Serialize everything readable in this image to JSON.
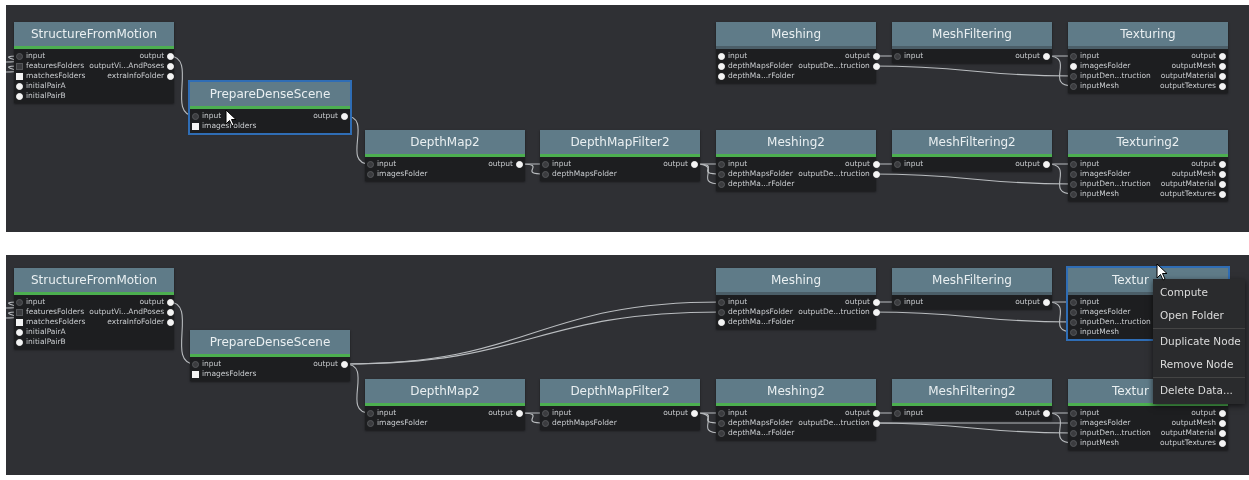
{
  "panels": [
    {
      "nodes": [
        {
          "title": "StructureFromMotion",
          "selected": false,
          "done": true,
          "inputs": [
            {
              "name": "input",
              "kind": "linked"
            },
            {
              "name": "featuresFolders",
              "kind": "linked-list"
            },
            {
              "name": "matchesFolders",
              "kind": "list"
            },
            {
              "name": "initialPairA",
              "kind": "open"
            },
            {
              "name": "initialPairB",
              "kind": "open"
            }
          ],
          "outputs": [
            {
              "name": "output",
              "kind": "open"
            },
            {
              "name": "outputVi...AndPoses",
              "kind": "open"
            },
            {
              "name": "extraInfoFolder",
              "kind": "open"
            }
          ]
        },
        {
          "title": "PrepareDenseScene",
          "selected": true,
          "done": true,
          "inputs": [
            {
              "name": "input",
              "kind": "linked"
            },
            {
              "name": "imagesFolders",
              "kind": "list"
            }
          ],
          "outputs": [
            {
              "name": "output",
              "kind": "open"
            }
          ]
        },
        {
          "title": "Meshing",
          "selected": false,
          "done": false,
          "inputs": [
            {
              "name": "input",
              "kind": "open"
            },
            {
              "name": "depthMapsFolder",
              "kind": "open"
            },
            {
              "name": "depthMa...rFolder",
              "kind": "open"
            }
          ],
          "outputs": [
            {
              "name": "output",
              "kind": "open"
            },
            {
              "name": "outputDe...truction",
              "kind": "open"
            }
          ]
        },
        {
          "title": "MeshFiltering",
          "selected": false,
          "done": false,
          "inputs": [
            {
              "name": "input",
              "kind": "linked"
            }
          ],
          "outputs": [
            {
              "name": "output",
              "kind": "open"
            }
          ]
        },
        {
          "title": "Texturing",
          "selected": false,
          "done": false,
          "inputs": [
            {
              "name": "input",
              "kind": "linked"
            },
            {
              "name": "imagesFolder",
              "kind": "open"
            },
            {
              "name": "inputDen...truction",
              "kind": "linked"
            },
            {
              "name": "inputMesh",
              "kind": "linked"
            }
          ],
          "outputs": [
            {
              "name": "output",
              "kind": "open"
            },
            {
              "name": "outputMesh",
              "kind": "open"
            },
            {
              "name": "outputMaterial",
              "kind": "open"
            },
            {
              "name": "outputTextures",
              "kind": "open"
            }
          ]
        },
        {
          "title": "DepthMap2",
          "selected": false,
          "done": true,
          "inputs": [
            {
              "name": "input",
              "kind": "linked"
            },
            {
              "name": "imagesFolder",
              "kind": "linked"
            }
          ],
          "outputs": [
            {
              "name": "output",
              "kind": "open"
            }
          ]
        },
        {
          "title": "DepthMapFilter2",
          "selected": false,
          "done": true,
          "inputs": [
            {
              "name": "input",
              "kind": "linked"
            },
            {
              "name": "depthMapsFolder",
              "kind": "linked"
            }
          ],
          "outputs": [
            {
              "name": "output",
              "kind": "open"
            }
          ]
        },
        {
          "title": "Meshing2",
          "selected": false,
          "done": true,
          "inputs": [
            {
              "name": "input",
              "kind": "linked"
            },
            {
              "name": "depthMapsFolder",
              "kind": "linked"
            },
            {
              "name": "depthMa...rFolder",
              "kind": "linked"
            }
          ],
          "outputs": [
            {
              "name": "output",
              "kind": "open"
            },
            {
              "name": "outputDe...truction",
              "kind": "open"
            }
          ]
        },
        {
          "title": "MeshFiltering2",
          "selected": false,
          "done": true,
          "inputs": [
            {
              "name": "input",
              "kind": "linked"
            }
          ],
          "outputs": [
            {
              "name": "output",
              "kind": "open"
            }
          ]
        },
        {
          "title": "Texturing2",
          "selected": false,
          "done": true,
          "inputs": [
            {
              "name": "input",
              "kind": "linked"
            },
            {
              "name": "imagesFolder",
              "kind": "linked"
            },
            {
              "name": "inputDen...truction",
              "kind": "linked"
            },
            {
              "name": "inputMesh",
              "kind": "linked"
            }
          ],
          "outputs": [
            {
              "name": "output",
              "kind": "open"
            },
            {
              "name": "outputMesh",
              "kind": "open"
            },
            {
              "name": "outputMaterial",
              "kind": "open"
            },
            {
              "name": "outputTextures",
              "kind": "open"
            }
          ]
        }
      ]
    },
    {
      "nodes": [
        {
          "title": "StructureFromMotion",
          "selected": false,
          "done": true,
          "inputs": [
            {
              "name": "input",
              "kind": "linked"
            },
            {
              "name": "featuresFolders",
              "kind": "linked-list"
            },
            {
              "name": "matchesFolders",
              "kind": "list"
            },
            {
              "name": "initialPairA",
              "kind": "open"
            },
            {
              "name": "initialPairB",
              "kind": "open"
            }
          ],
          "outputs": [
            {
              "name": "output",
              "kind": "open"
            },
            {
              "name": "outputVi...AndPoses",
              "kind": "open"
            },
            {
              "name": "extraInfoFolder",
              "kind": "open"
            }
          ]
        },
        {
          "title": "PrepareDenseScene",
          "selected": false,
          "done": true,
          "inputs": [
            {
              "name": "input",
              "kind": "linked"
            },
            {
              "name": "imagesFolders",
              "kind": "list"
            }
          ],
          "outputs": [
            {
              "name": "output",
              "kind": "open"
            }
          ]
        },
        {
          "title": "Meshing",
          "selected": false,
          "done": false,
          "inputs": [
            {
              "name": "input",
              "kind": "linked"
            },
            {
              "name": "depthMapsFolder",
              "kind": "linked"
            },
            {
              "name": "depthMa...rFolder",
              "kind": "open"
            }
          ],
          "outputs": [
            {
              "name": "output",
              "kind": "open"
            },
            {
              "name": "outputDe...truction",
              "kind": "open"
            }
          ]
        },
        {
          "title": "MeshFiltering",
          "selected": false,
          "done": false,
          "inputs": [
            {
              "name": "input",
              "kind": "linked"
            }
          ],
          "outputs": [
            {
              "name": "output",
              "kind": "open"
            }
          ]
        },
        {
          "title": "Textur",
          "selected": true,
          "done": false,
          "inputs": [
            {
              "name": "input",
              "kind": "linked"
            },
            {
              "name": "imagesFolder",
              "kind": "linked"
            },
            {
              "name": "inputDen...truction",
              "kind": "linked"
            },
            {
              "name": "inputMesh",
              "kind": "linked"
            }
          ]
        },
        {
          "title": "DepthMap2",
          "selected": false,
          "done": true,
          "inputs": [
            {
              "name": "input",
              "kind": "linked"
            },
            {
              "name": "imagesFolder",
              "kind": "linked"
            }
          ],
          "outputs": [
            {
              "name": "output",
              "kind": "open"
            }
          ]
        },
        {
          "title": "DepthMapFilter2",
          "selected": false,
          "done": true,
          "inputs": [
            {
              "name": "input",
              "kind": "linked"
            },
            {
              "name": "depthMapsFolder",
              "kind": "linked"
            }
          ],
          "outputs": [
            {
              "name": "output",
              "kind": "open"
            }
          ]
        },
        {
          "title": "Meshing2",
          "selected": false,
          "done": true,
          "inputs": [
            {
              "name": "input",
              "kind": "linked"
            },
            {
              "name": "depthMapsFolder",
              "kind": "linked"
            },
            {
              "name": "depthMa...rFolder",
              "kind": "linked"
            }
          ],
          "outputs": [
            {
              "name": "output",
              "kind": "open"
            },
            {
              "name": "outputDe...truction",
              "kind": "open"
            }
          ]
        },
        {
          "title": "MeshFiltering2",
          "selected": false,
          "done": true,
          "inputs": [
            {
              "name": "input",
              "kind": "linked"
            }
          ],
          "outputs": [
            {
              "name": "output",
              "kind": "open"
            }
          ]
        },
        {
          "title": "Textur",
          "selected": false,
          "done": true,
          "inputs": [
            {
              "name": "input",
              "kind": "linked"
            },
            {
              "name": "imagesFolder",
              "kind": "linked"
            },
            {
              "name": "inputDen...truction",
              "kind": "linked"
            },
            {
              "name": "inputMesh",
              "kind": "linked"
            }
          ],
          "outputs": [
            {
              "name": "output",
              "kind": "open"
            },
            {
              "name": "outputMesh",
              "kind": "open"
            },
            {
              "name": "outputMaterial",
              "kind": "open"
            },
            {
              "name": "outputTextures",
              "kind": "open"
            }
          ]
        }
      ],
      "context_menu": {
        "groups": [
          [
            "Compute",
            "Open Folder"
          ],
          [
            "Duplicate Node",
            "Remove Node"
          ],
          [
            "Delete Data..."
          ]
        ]
      }
    }
  ]
}
